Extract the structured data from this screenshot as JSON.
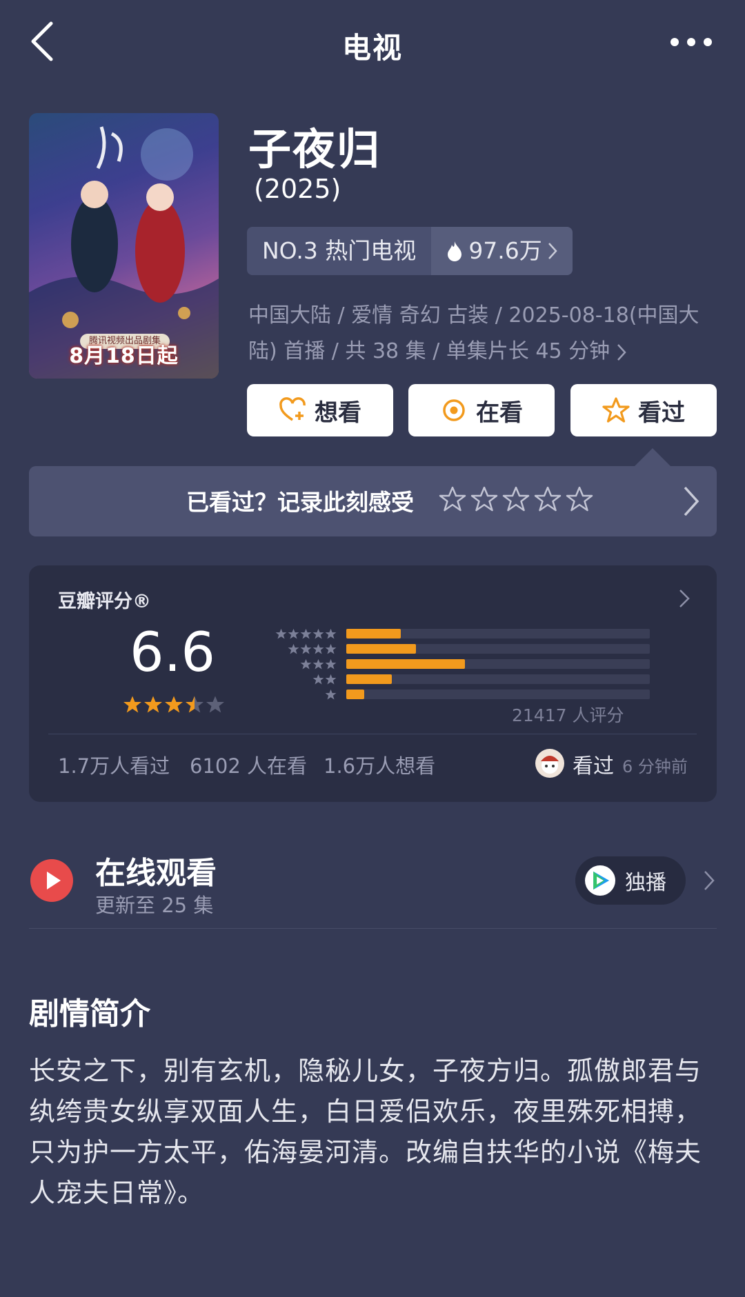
{
  "nav": {
    "title": "电视",
    "back_icon": "chevron-left-icon",
    "more_icon": "more-dots-icon"
  },
  "movie": {
    "title": "子夜归",
    "year": "(2025)",
    "poster": {
      "badge": "腾讯视频出品剧集",
      "date": "8月18日起"
    },
    "rank": {
      "label": "NO.3 热门电视",
      "heat": "97.6万"
    },
    "meta": "中国大陆 / 爱情 奇幻 古装 / 2025-08-18(中国大陆) 首播 / 共 38 集 / 单集片长 45 分钟"
  },
  "actions": {
    "want": "想看",
    "watching": "在看",
    "watched": "看过"
  },
  "recorder": {
    "text": "已看过？记录此刻感受",
    "stars": 5
  },
  "rating": {
    "label": "豆瓣评分®",
    "score": "6.6",
    "stars_value": 3.5,
    "distribution": [
      {
        "stars": 5,
        "fraction": 0.18
      },
      {
        "stars": 4,
        "fraction": 0.23
      },
      {
        "stars": 3,
        "fraction": 0.39
      },
      {
        "stars": 2,
        "fraction": 0.15
      },
      {
        "stars": 1,
        "fraction": 0.06
      }
    ],
    "count": "21417 人评分",
    "watched_count": "1.7万人看过",
    "watching_count": "6102 人在看",
    "want_count": "1.6万人想看",
    "friend_status": "看过",
    "friend_time": "6 分钟前"
  },
  "watch": {
    "title": "在线观看",
    "subtitle": "更新至 25 集",
    "badge": "独播"
  },
  "synopsis": {
    "heading": "剧情简介",
    "text": "长安之下，别有玄机，隐秘儿女，子夜方归。孤傲郎君与纨绔贵女纵享双面人生，白日爱侣欢乐，夜里殊死相搏，只为护一方太平，佑海晏河清。改编自扶华的小说《梅夫人宠夫日常》。"
  },
  "colors": {
    "background": "#353a55",
    "accent": "#f29a1d",
    "card": "#2a2e44",
    "play": "#e84b4b"
  }
}
